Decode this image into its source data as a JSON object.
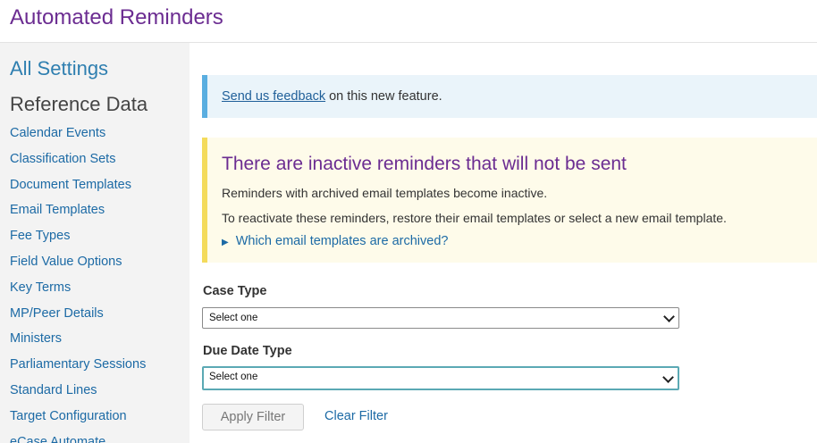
{
  "header": {
    "title": "Automated Reminders"
  },
  "sidebar": {
    "all_settings": "All Settings",
    "section_title": "Reference Data",
    "items": [
      {
        "label": "Calendar Events"
      },
      {
        "label": "Classification Sets"
      },
      {
        "label": "Document Templates"
      },
      {
        "label": "Email Templates"
      },
      {
        "label": "Fee Types"
      },
      {
        "label": "Field Value Options"
      },
      {
        "label": "Key Terms"
      },
      {
        "label": "MP/Peer Details"
      },
      {
        "label": "Ministers"
      },
      {
        "label": "Parliamentary Sessions"
      },
      {
        "label": "Standard Lines"
      },
      {
        "label": "Target Configuration"
      },
      {
        "label": "eCase Automate"
      }
    ]
  },
  "feedback": {
    "link_text": "Send us feedback",
    "suffix": " on this new feature."
  },
  "warning": {
    "title": "There are inactive reminders that will not be sent",
    "line1": "Reminders with archived email templates become inactive.",
    "line2": "To reactivate these reminders, restore their email templates or select a new email template.",
    "details_toggle": "Which email templates are archived?"
  },
  "filters": {
    "case_type_label": "Case Type",
    "case_type_value": "Select one",
    "due_date_type_label": "Due Date Type",
    "due_date_type_value": "Select one",
    "apply_label": "Apply Filter",
    "clear_label": "Clear Filter"
  },
  "colors": {
    "brand_purple": "#6b2c91",
    "link_blue": "#1c6aa5",
    "info_border": "#5aaee0",
    "warning_border": "#f4db5c",
    "focus_border": "#5ba9b4"
  }
}
